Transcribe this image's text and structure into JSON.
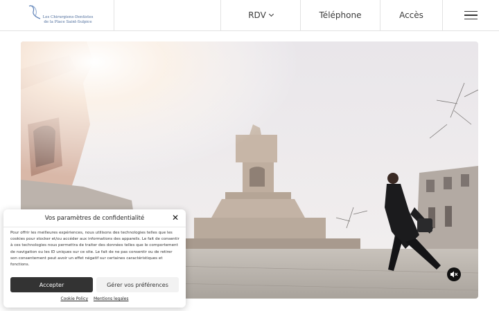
{
  "header": {
    "logo_line1": "Les Chirurgiens-Dentistes",
    "logo_line2": "de la Place Saint-Sulpice",
    "nav": {
      "rdv": "RDV",
      "telephone": "Téléphone",
      "acces": "Accès"
    }
  },
  "cookie": {
    "title": "Vos paramètres de confidentialité",
    "body": "Pour offrir les meilleures expériences, nous utilisons des technologies telles que les cookies pour stocker et/ou accéder aux informations des appareils. Le fait de consentir à ces technologies nous permettra de traiter des données telles que le comportement de navigation ou les ID uniques sur ce site. Le fait de ne pas consentir ou de retirer son consentement peut avoir un effet négatif sur certaines caractéristiques et fonctions.",
    "accept_label": "Accepter",
    "prefs_label": "Gérer vos préférences",
    "links": [
      "Cookie Policy",
      "Mentions legales"
    ]
  },
  "colors": {
    "accent_dark": "#333333",
    "logo_blue": "#4a6a9a",
    "header_border": "#e2e2e2"
  },
  "icons": {
    "menu": "hamburger-icon",
    "mute": "speaker-muted-icon",
    "close": "close-icon",
    "dropdown": "chevron-down-icon"
  }
}
